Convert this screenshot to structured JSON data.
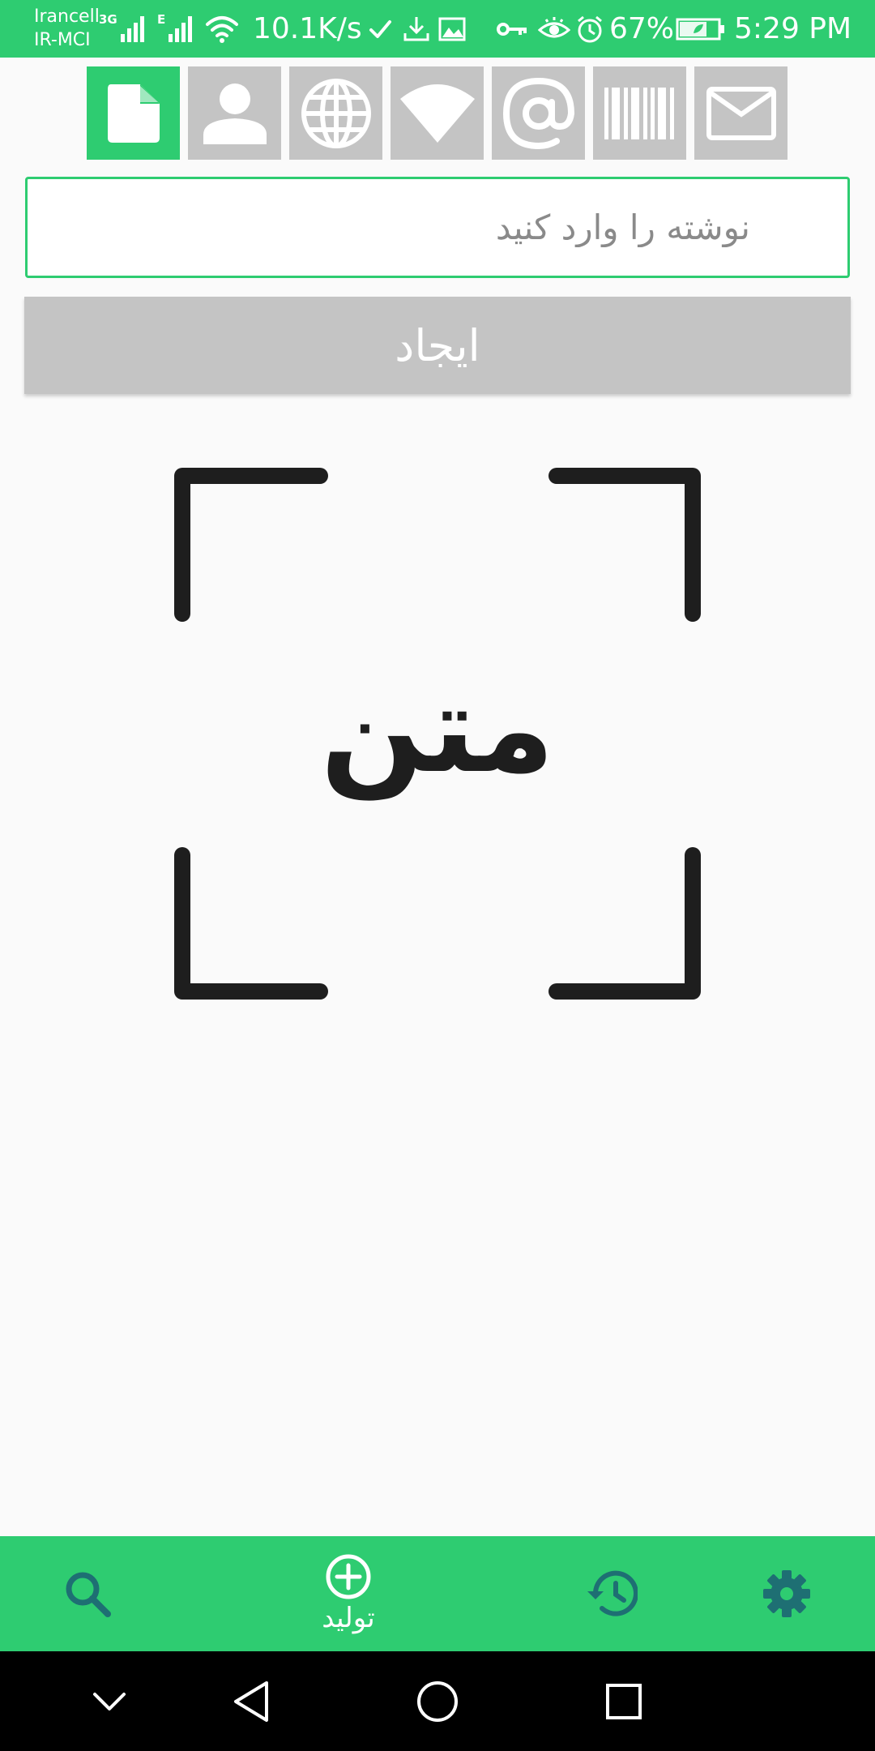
{
  "status_bar": {
    "carrier_line1": "Irancell",
    "carrier_line2": "IR-MCI",
    "network_3g": "3G",
    "network_e": "E",
    "data_speed": "10.1K/s",
    "battery_percent": "67%",
    "time": "5:29 PM"
  },
  "type_tabs": [
    {
      "icon": "file-icon",
      "active": true
    },
    {
      "icon": "person-icon",
      "active": false
    },
    {
      "icon": "globe-icon",
      "active": false
    },
    {
      "icon": "wifi-icon",
      "active": false
    },
    {
      "icon": "at-icon",
      "active": false
    },
    {
      "icon": "barcode-icon",
      "active": false
    },
    {
      "icon": "mail-icon",
      "active": false
    }
  ],
  "input": {
    "placeholder": "نوشته را وارد کنید",
    "value": ""
  },
  "create_button": {
    "label": "ایجاد"
  },
  "preview": {
    "label": "متن"
  },
  "bottom_nav": {
    "generate_label": "تولید",
    "items": [
      "search-icon",
      "add-circle-icon",
      "history-icon",
      "settings-icon"
    ]
  },
  "colors": {
    "accent": "#2ecc71",
    "tab_inactive": "#c4c4c4",
    "nav_icon_dark": "#1e6f73",
    "background": "#fafafa"
  }
}
